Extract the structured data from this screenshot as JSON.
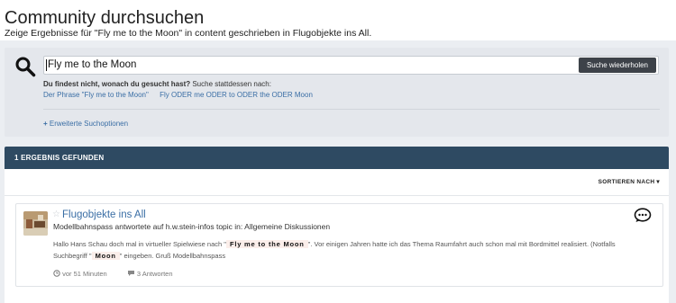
{
  "page": {
    "title": "Community durchsuchen",
    "subtitle": "Zeige Ergebnisse für \"Fly me to the Moon\" in content geschrieben in Flugobjekte ins All."
  },
  "search": {
    "value": "Fly me to the Moon",
    "button_label": "Suche wiederholen",
    "not_found_bold": "Du findest nicht, wonach du gesucht hast?",
    "not_found_rest": " Suche stattdessen nach:",
    "suggestions": [
      "Der Phrase \"Fly me to the Moon\"",
      "Fly ODER me ODER to ODER the ODER Moon"
    ],
    "advanced_label": "Erweiterte Suchoptionen"
  },
  "results": {
    "count_label": "1 ERGEBNIS GEFUNDEN",
    "sort_label": "SORTIEREN NACH",
    "items": [
      {
        "title": "Flugobjekte ins All",
        "meta": "Modellbahnspass antwortete auf h.w.stein-infos topic in: Allgemeine Diskussionen",
        "body_1": "Hallo Hans Schau doch mal in virtueller Spielwiese nach \"",
        "highlight_1": "Fly me to the Moon",
        "body_2": "\". Vor einigen Jahren hatte ich das Thema Raumfahrt auch schon mal mit Bordmittel realisiert. (Notfalls Suchbegriff \"",
        "highlight_2": "Moon",
        "body_3": "\" eingeben. Gruß Modellbahnspass",
        "time": "vor 51 Minuten",
        "replies": "3 Antworten"
      }
    ]
  },
  "colors": {
    "accent_link": "#3a6ea5",
    "results_bar": "#2e4a62",
    "search_button": "#3d4249"
  }
}
